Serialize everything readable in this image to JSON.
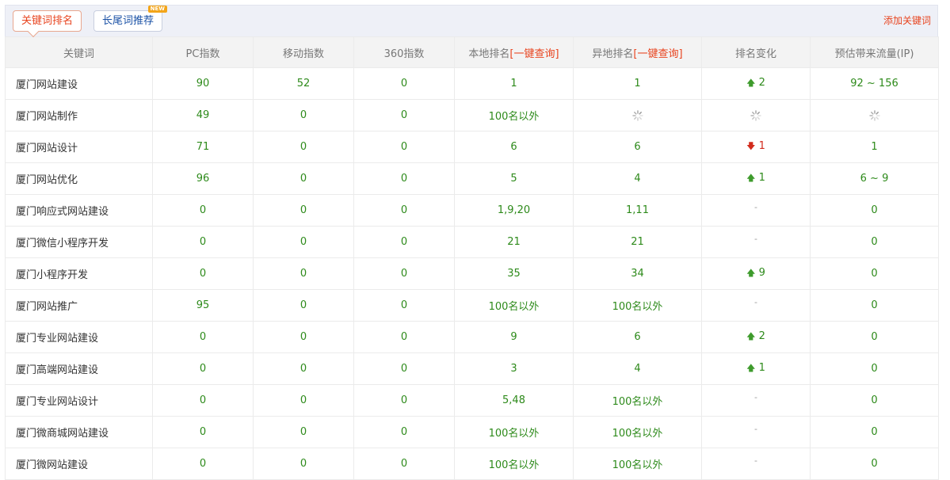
{
  "tabs": {
    "keyword_rank": "关键词排名",
    "longtail": "长尾词推荐",
    "new_badge": "NEW"
  },
  "add_keyword": "添加关键词",
  "table": {
    "headers": {
      "keyword": "关键词",
      "pc_index": "PC指数",
      "mobile_index": "移动指数",
      "index_360": "360指数",
      "local_rank": "本地排名",
      "remote_rank": "异地排名",
      "one_click_query": "[一键查询]",
      "rank_change": "排名变化",
      "traffic": "预估带来流量(IP)"
    },
    "rows": [
      {
        "kw": "厦门网站建设",
        "pc": "90",
        "mobile": "52",
        "s360": "0",
        "local": "1",
        "remote": "1",
        "change": "2",
        "dir": "up",
        "traffic": "92 ~ 156"
      },
      {
        "kw": "厦门网站制作",
        "pc": "49",
        "mobile": "0",
        "s360": "0",
        "local": "100名以外",
        "remote": "",
        "change": "",
        "dir": "loading",
        "traffic": ""
      },
      {
        "kw": "厦门网站设计",
        "pc": "71",
        "mobile": "0",
        "s360": "0",
        "local": "6",
        "remote": "6",
        "change": "1",
        "dir": "down",
        "traffic": "1"
      },
      {
        "kw": "厦门网站优化",
        "pc": "96",
        "mobile": "0",
        "s360": "0",
        "local": "5",
        "remote": "4",
        "change": "1",
        "dir": "up",
        "traffic": "6 ~ 9"
      },
      {
        "kw": "厦门响应式网站建设",
        "pc": "0",
        "mobile": "0",
        "s360": "0",
        "local": "1,9,20",
        "remote": "1,11",
        "change": "-",
        "dir": "none",
        "traffic": "0"
      },
      {
        "kw": "厦门微信小程序开发",
        "pc": "0",
        "mobile": "0",
        "s360": "0",
        "local": "21",
        "remote": "21",
        "change": "-",
        "dir": "none",
        "traffic": "0"
      },
      {
        "kw": "厦门小程序开发",
        "pc": "0",
        "mobile": "0",
        "s360": "0",
        "local": "35",
        "remote": "34",
        "change": "9",
        "dir": "up",
        "traffic": "0"
      },
      {
        "kw": "厦门网站推广",
        "pc": "95",
        "mobile": "0",
        "s360": "0",
        "local": "100名以外",
        "remote": "100名以外",
        "change": "-",
        "dir": "none",
        "traffic": "0"
      },
      {
        "kw": "厦门专业网站建设",
        "pc": "0",
        "mobile": "0",
        "s360": "0",
        "local": "9",
        "remote": "6",
        "change": "2",
        "dir": "up",
        "traffic": "0"
      },
      {
        "kw": "厦门高端网站建设",
        "pc": "0",
        "mobile": "0",
        "s360": "0",
        "local": "3",
        "remote": "4",
        "change": "1",
        "dir": "up",
        "traffic": "0"
      },
      {
        "kw": "厦门专业网站设计",
        "pc": "0",
        "mobile": "0",
        "s360": "0",
        "local": "5,48",
        "remote": "100名以外",
        "change": "-",
        "dir": "none",
        "traffic": "0"
      },
      {
        "kw": "厦门微商城网站建设",
        "pc": "0",
        "mobile": "0",
        "s360": "0",
        "local": "100名以外",
        "remote": "100名以外",
        "change": "-",
        "dir": "none",
        "traffic": "0"
      },
      {
        "kw": "厦门微网站建设",
        "pc": "0",
        "mobile": "0",
        "s360": "0",
        "local": "100名以外",
        "remote": "100名以外",
        "change": "-",
        "dir": "none",
        "traffic": "0"
      }
    ]
  }
}
